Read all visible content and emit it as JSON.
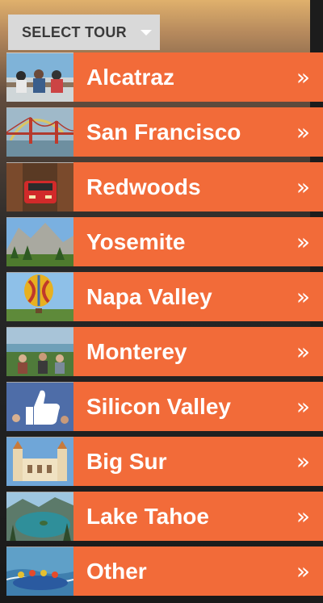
{
  "dropdown": {
    "label": "SELECT TOUR",
    "caret_icon": "caret-down-icon"
  },
  "menu": {
    "accent_color": "#f26b39",
    "chevron_glyph": "»",
    "items": [
      {
        "label": "Alcatraz",
        "thumb": "ferry-passengers-photo"
      },
      {
        "label": "San Francisco",
        "thumb": "golden-gate-bridge-rainbow-photo"
      },
      {
        "label": "Redwoods",
        "thumb": "red-car-redwood-tunnel-photo"
      },
      {
        "label": "Yosemite",
        "thumb": "yosemite-valley-photo"
      },
      {
        "label": "Napa Valley",
        "thumb": "hot-air-balloon-photo"
      },
      {
        "label": "Monterey",
        "thumb": "monterey-coast-group-photo"
      },
      {
        "label": "Silicon Valley",
        "thumb": "facebook-like-sign-photo"
      },
      {
        "label": "Big Sur",
        "thumb": "hearst-castle-photo"
      },
      {
        "label": "Lake Tahoe",
        "thumb": "emerald-bay-photo"
      },
      {
        "label": "Other",
        "thumb": "river-rafting-photo"
      }
    ]
  }
}
